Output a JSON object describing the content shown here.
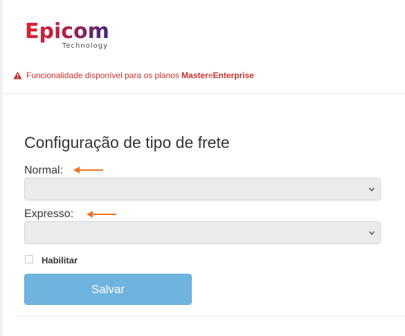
{
  "logo": {
    "name": "Epicom",
    "tagline": "Technology"
  },
  "alert": {
    "prefix": "Funcionalidade disponível para os planos ",
    "plan1": "Master",
    "conjunction": " e ",
    "plan2": "Enterprise",
    "icon": "warning-icon",
    "color": "#c9302c"
  },
  "form": {
    "title": "Configuração de tipo de frete",
    "normal_label": "Normal:",
    "normal_value": "",
    "expresso_label": "Expresso:",
    "expresso_value": "",
    "habilitar_label": "Habilitar",
    "habilitar_checked": false,
    "save_label": "Salvar"
  },
  "annotations": {
    "arrow_color": "#f07020"
  },
  "colors": {
    "button": "#6fb4de",
    "select_bg": "#ebebeb",
    "brand_red": "#d9262e",
    "brand_purple": "#3d2a7c"
  }
}
